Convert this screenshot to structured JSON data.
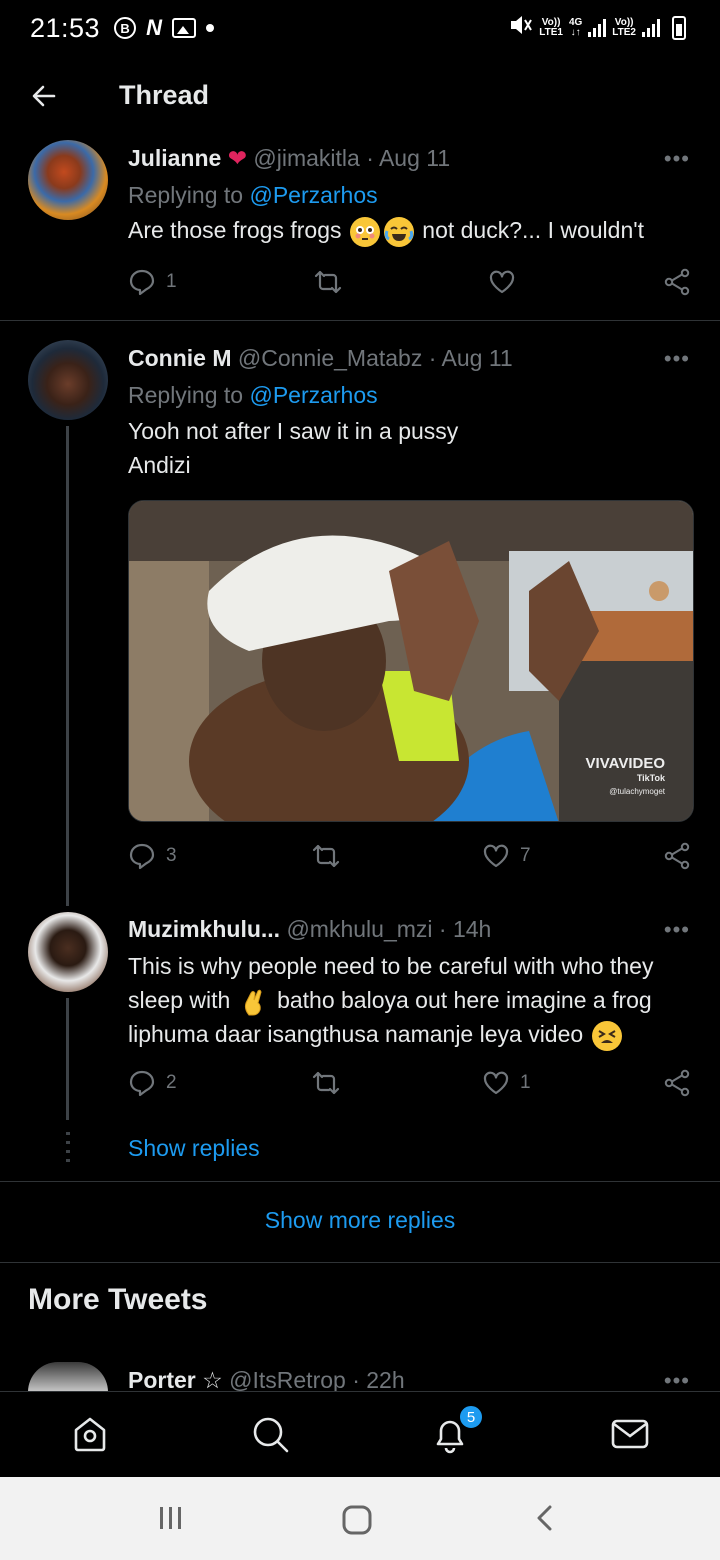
{
  "status_bar": {
    "time": "21:53",
    "left_icons": [
      "bixby-b-icon",
      "n-icon",
      "gallery-icon",
      "dot"
    ],
    "sim1_label_top": "Vo))",
    "sim1_label_bottom": "LTE1",
    "net_label_top": "4G",
    "sim2_label_top": "Vo))",
    "sim2_label_bottom": "LTE2"
  },
  "header": {
    "title": "Thread"
  },
  "tweets": [
    {
      "name": "Julianne",
      "name_emoji": "❤️",
      "handle": "@jimakitla",
      "time": "· Aug 11",
      "replying_label": "Replying to",
      "replying_to": "@Perzarhos",
      "text_part1": "Are those frogs frogs",
      "text_part2": "not duck?... I wouldn't",
      "replies": "1",
      "retweets": "",
      "likes": ""
    },
    {
      "name": "Connie M",
      "handle": "@Connie_Matabz",
      "time": "· Aug 11",
      "replying_label": "Replying to",
      "replying_to": "@Perzarhos",
      "text_line1": "Yooh not after I saw it in a pussy",
      "text_line2": "Andizi",
      "media_watermark": "VIVAVIDEO",
      "media_tiktok": "TikTok",
      "media_user": "@tulachymoget",
      "replies": "3",
      "retweets": "",
      "likes": "7"
    },
    {
      "name": "Muzimkhulu...",
      "handle": "@mkhulu_mzi",
      "time": "· 14h",
      "text_line1": "This is why people need to be careful with who they",
      "text_line2_a": "sleep with",
      "text_line2_b": "batho baloya out here imagine a frog",
      "text_line3": "liphuma daar isangthusa namanje leya video",
      "replies": "2",
      "retweets": "",
      "likes": "1"
    }
  ],
  "show_replies": "Show replies",
  "show_more_replies": "Show more replies",
  "more_tweets_title": "More Tweets",
  "next_tweet": {
    "name": "Porter",
    "star": "☆",
    "handle": "@ItsRetrop",
    "time": "· 22h"
  },
  "bottom_nav": {
    "items": [
      "home-icon",
      "search-icon",
      "notifications-icon",
      "messages-icon"
    ],
    "notifications_badge": "5"
  },
  "colors": {
    "accent": "#1d9bf0",
    "muted": "#71767b",
    "background": "#000000"
  }
}
